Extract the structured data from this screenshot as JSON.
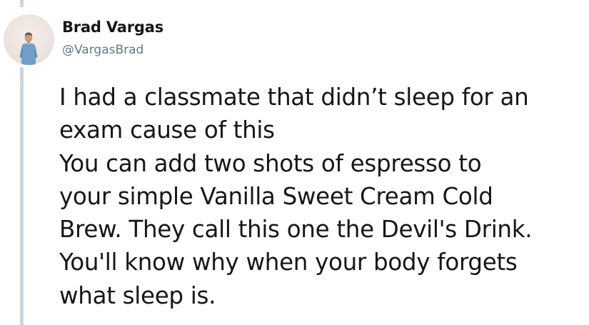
{
  "author": {
    "display_name": "Brad Vargas",
    "handle": "@VargasBrad"
  },
  "tweet": {
    "lines": [
      "I had a classmate that didn’t sleep for an",
      "exam cause of this",
      "You can add two shots of espresso to",
      "your simple Vanilla Sweet Cream Cold",
      "Brew. They call this one the Devil's Drink.",
      "You'll know why when your body forgets",
      "what sleep is."
    ]
  },
  "colors": {
    "text": "#14171a",
    "handle": "#657786",
    "thread_line": "#ccd6dd"
  }
}
